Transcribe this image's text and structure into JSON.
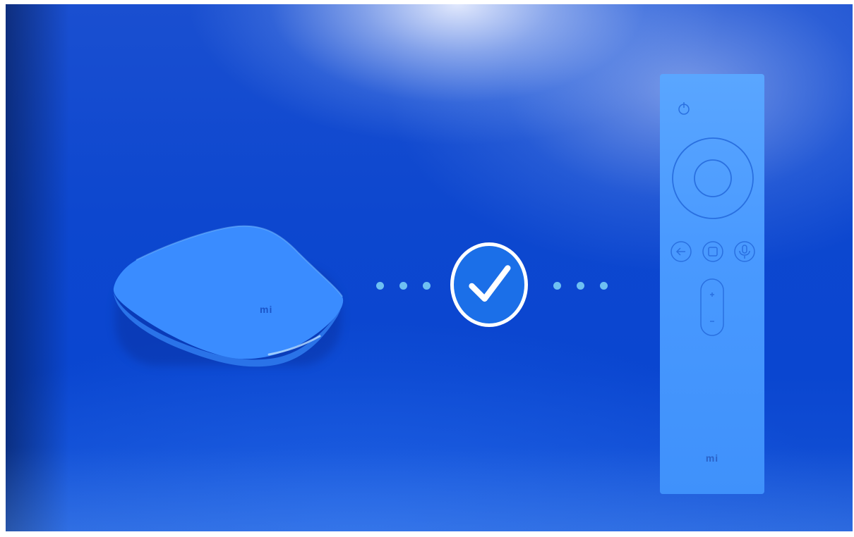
{
  "screen": {
    "name": "remote-pairing-success"
  },
  "box": {
    "logo": "mi"
  },
  "remote": {
    "logo": "mi",
    "buttons": [
      "power-icon",
      "dpad-ring",
      "ok-button",
      "back-icon",
      "home-icon",
      "mic-icon",
      "volume-rocker"
    ]
  },
  "status": {
    "icon": "checkmark-icon",
    "state": "paired"
  },
  "colors": {
    "background": "#0d47cf",
    "device": "#3b8dff",
    "dots": "#6ec0f2",
    "check_ring": "#ffffff"
  }
}
